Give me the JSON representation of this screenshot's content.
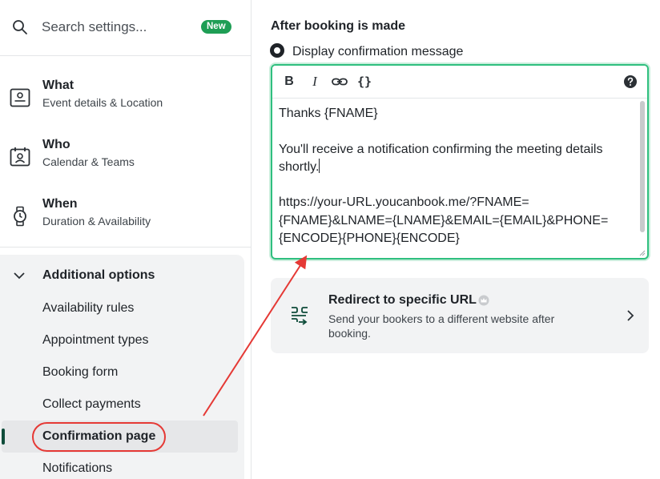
{
  "sidebar": {
    "search": {
      "placeholder": "Search settings...",
      "badge": "New",
      "icon": "search-icon"
    },
    "nav": [
      {
        "title": "What",
        "subtitle": "Event details & Location",
        "icon": "id-card-icon"
      },
      {
        "title": "Who",
        "subtitle": "Calendar & Teams",
        "icon": "calendar-person-icon"
      },
      {
        "title": "When",
        "subtitle": "Duration & Availability",
        "icon": "watch-icon"
      }
    ],
    "additional_options": {
      "title": "Additional options",
      "expanded": true,
      "items": [
        {
          "label": "Availability rules"
        },
        {
          "label": "Appointment types"
        },
        {
          "label": "Booking form"
        },
        {
          "label": "Collect payments"
        },
        {
          "label": "Confirmation page",
          "active": true
        },
        {
          "label": "Notifications"
        }
      ]
    }
  },
  "main": {
    "section_title": "After booking is made",
    "option_display": {
      "label": "Display confirmation message",
      "selected": true
    },
    "editor": {
      "toolbar": {
        "bold": "B",
        "italic": "I",
        "link": "link-icon",
        "code": "{}",
        "help": "help-icon"
      },
      "lines": {
        "greeting": "Thanks {FNAME}",
        "message": "You'll receive a notification confirming the meeting details shortly.",
        "url": "https://your-URL.youcanbook.me/?FNAME={FNAME}&LNAME={LNAME}&EMAIL={EMAIL}&PHONE={ENCODE}{PHONE}{ENCODE}"
      }
    },
    "redirect": {
      "title": "Redirect to specific URL",
      "description": "Send your bookers to a different website after booking.",
      "icon": "redirect-arrows-icon",
      "badge_icon": "crown-icon"
    }
  },
  "colors": {
    "accent_green": "#2fbf7f",
    "badge_green": "#1e9e55",
    "active_bar": "#0f4c3a",
    "annotation_red": "#e53935"
  }
}
